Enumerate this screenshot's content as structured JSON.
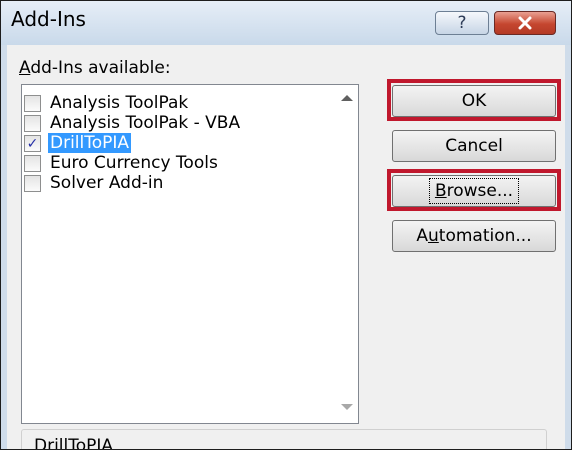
{
  "dialog": {
    "title": "Add-Ins",
    "help_glyph": "?",
    "close_icon": "close-icon"
  },
  "list": {
    "label_mnemonic": "A",
    "label_rest": "dd-Ins available:",
    "items": [
      {
        "label": "Analysis ToolPak",
        "checked": false,
        "selected": false
      },
      {
        "label": "Analysis ToolPak - VBA",
        "checked": false,
        "selected": false
      },
      {
        "label": "DrillToPIA",
        "checked": true,
        "selected": true
      },
      {
        "label": "Euro Currency Tools",
        "checked": false,
        "selected": false
      },
      {
        "label": "Solver Add-in",
        "checked": false,
        "selected": false
      }
    ]
  },
  "buttons": {
    "ok": "OK",
    "cancel": "Cancel",
    "browse_mnemonic": "B",
    "browse_rest": "rowse...",
    "automation_pre": "A",
    "automation_mnemonic": "u",
    "automation_rest": "tomation..."
  },
  "description": {
    "title": "DrillToPIA"
  },
  "colors": {
    "highlight": "#c0182d",
    "selection": "#3399ff"
  }
}
